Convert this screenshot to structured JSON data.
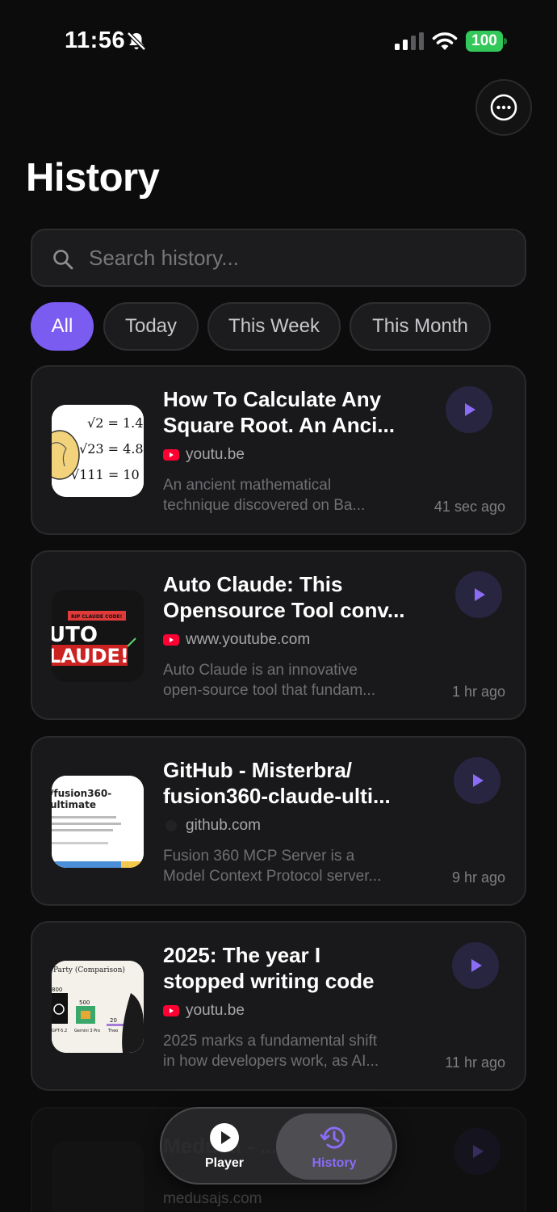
{
  "status_bar": {
    "time": "11:56",
    "battery": "100",
    "icons": [
      "bell-slash-icon",
      "cellular-signal-icon",
      "wifi-icon",
      "battery-icon"
    ]
  },
  "header": {
    "title": "History",
    "more_icon": "ellipsis-circle-icon"
  },
  "search": {
    "placeholder": "Search history...",
    "value": ""
  },
  "filters": {
    "active": "All",
    "items": [
      "All",
      "Today",
      "This Week",
      "This Month"
    ]
  },
  "history": [
    {
      "title_line1": "How To Calculate Any",
      "title_line2": "Square Root. An Anci...",
      "source": "youtu.be",
      "source_icon": "youtube-icon",
      "desc_line1": "An ancient mathematical",
      "desc_line2": "technique discovered on Ba...",
      "time_ago": "41 sec ago"
    },
    {
      "title_line1": "Auto Claude: This",
      "title_line2": "Opensource Tool conv...",
      "source": "www.youtube.com",
      "source_icon": "youtube-icon",
      "desc_line1": "Auto Claude is an innovative",
      "desc_line2": "open-source tool that fundam...",
      "time_ago": "1 hr ago"
    },
    {
      "title_line1": "GitHub - Misterbra/",
      "title_line2": "fusion360-claude-ulti...",
      "source": "github.com",
      "source_icon": "github-icon",
      "desc_line1": "Fusion 360 MCP Server is a",
      "desc_line2": "Model Context Protocol server...",
      "time_ago": "9 hr ago"
    },
    {
      "title_line1": "2025: The year I",
      "title_line2": "stopped writing code",
      "source": "youtu.be",
      "source_icon": "youtube-icon",
      "desc_line1": "2025 marks a fundamental shift",
      "desc_line2": "in how developers work, as AI...",
      "time_ago": "11 hr ago"
    },
    {
      "title_line1": "Medusa - ...",
      "source": "medusajs.com"
    }
  ],
  "thumbnails": {
    "sqrt": [
      "√2 = 1.4",
      "√23 = 4.8",
      "√111 = 10"
    ],
    "auto_claude": [
      "RIP CLAUDE CODE!",
      "UTO",
      "LAUDE!"
    ],
    "fusion": [
      "/fusion360-",
      "ultimate"
    ],
    "party": [
      "Party (Comparison)",
      "800",
      "500",
      "20",
      "GPT-5.2",
      "Gemini 3 Pro",
      "Theo"
    ]
  },
  "bottom_nav": {
    "items": [
      {
        "label": "Player",
        "icon": "play-circle-icon"
      },
      {
        "label": "History",
        "icon": "clock-history-icon"
      }
    ],
    "active": "History"
  },
  "colors": {
    "accent": "#7b5cf0",
    "background": "#0c0c0d",
    "card": "#19191b",
    "battery": "#34c759",
    "youtube": "#ff0033"
  }
}
